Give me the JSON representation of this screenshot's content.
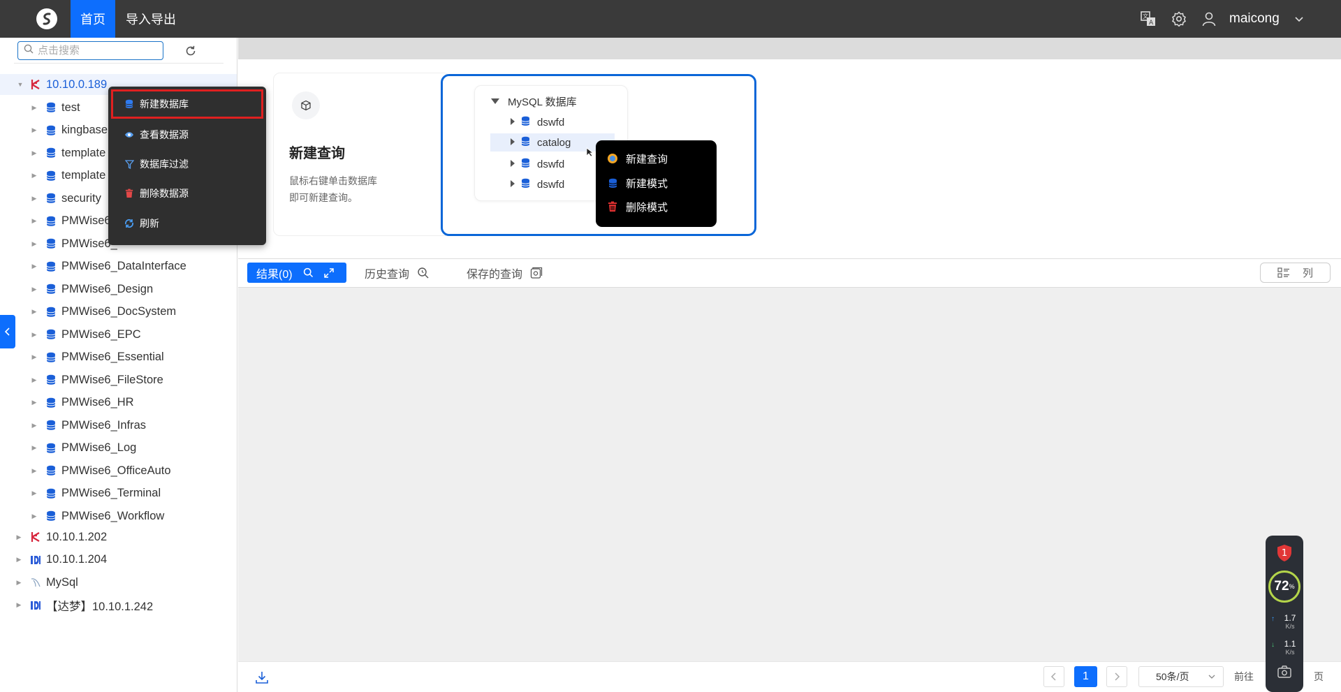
{
  "header": {
    "nav_home": "首页",
    "nav_import_export": "导入导出",
    "username": "maicong",
    "icons": [
      "translate-icon",
      "gear-icon",
      "user-icon",
      "chevron-down-icon"
    ]
  },
  "sidebar": {
    "search_placeholder": "点击搜索",
    "root": "10.10.0.189",
    "databases": [
      "test",
      "kingbase",
      "template",
      "template",
      "security",
      "PMWise6",
      "PMWise6_",
      "PMWise6_DataInterface",
      "PMWise6_Design",
      "PMWise6_DocSystem",
      "PMWise6_EPC",
      "PMWise6_Essential",
      "PMWise6_FileStore",
      "PMWise6_HR",
      "PMWise6_Infras",
      "PMWise6_Log",
      "PMWise6_OfficeAuto",
      "PMWise6_Terminal",
      "PMWise6_Workflow"
    ],
    "other_sources": [
      "10.10.1.202",
      "10.10.1.204",
      "MySql",
      "【达梦】10.10.1.242"
    ]
  },
  "context_menu": {
    "items": [
      "新建数据库",
      "查看数据源",
      "数据库过滤",
      "删除数据源",
      "刷新"
    ]
  },
  "welcome": {
    "card_title": "新建查询",
    "card_desc_line1": "鼠标右键单击数据库",
    "card_desc_line2": "即可新建查询。",
    "demo_root": "MySQL 数据库",
    "demo_items": [
      "dswfd",
      "catalog",
      "dswfd",
      "dswfd"
    ],
    "demo_menu": [
      "新建查询",
      "新建模式",
      "删除模式"
    ]
  },
  "results": {
    "tab_results": "结果(0)",
    "tab_history": "历史查询",
    "tab_saved": "保存的查询",
    "columns_button": "列"
  },
  "pagination": {
    "current_page": "1",
    "page_size": "50条/页",
    "goto_label": "前往",
    "page_suffix": "页"
  },
  "monitor": {
    "badge": "1",
    "cpu_percent": "72",
    "percent_sign": "%",
    "upload": "1.7",
    "download": "1.1",
    "unit": "K/s"
  },
  "colors": {
    "accent": "#0d6efd",
    "header_bg": "#3a3a3a",
    "menu_bg": "#2f2f2f",
    "highlight_border": "#e02020",
    "kingbase_icon": "#d7263d",
    "db_icon": "#1a5fd8"
  }
}
